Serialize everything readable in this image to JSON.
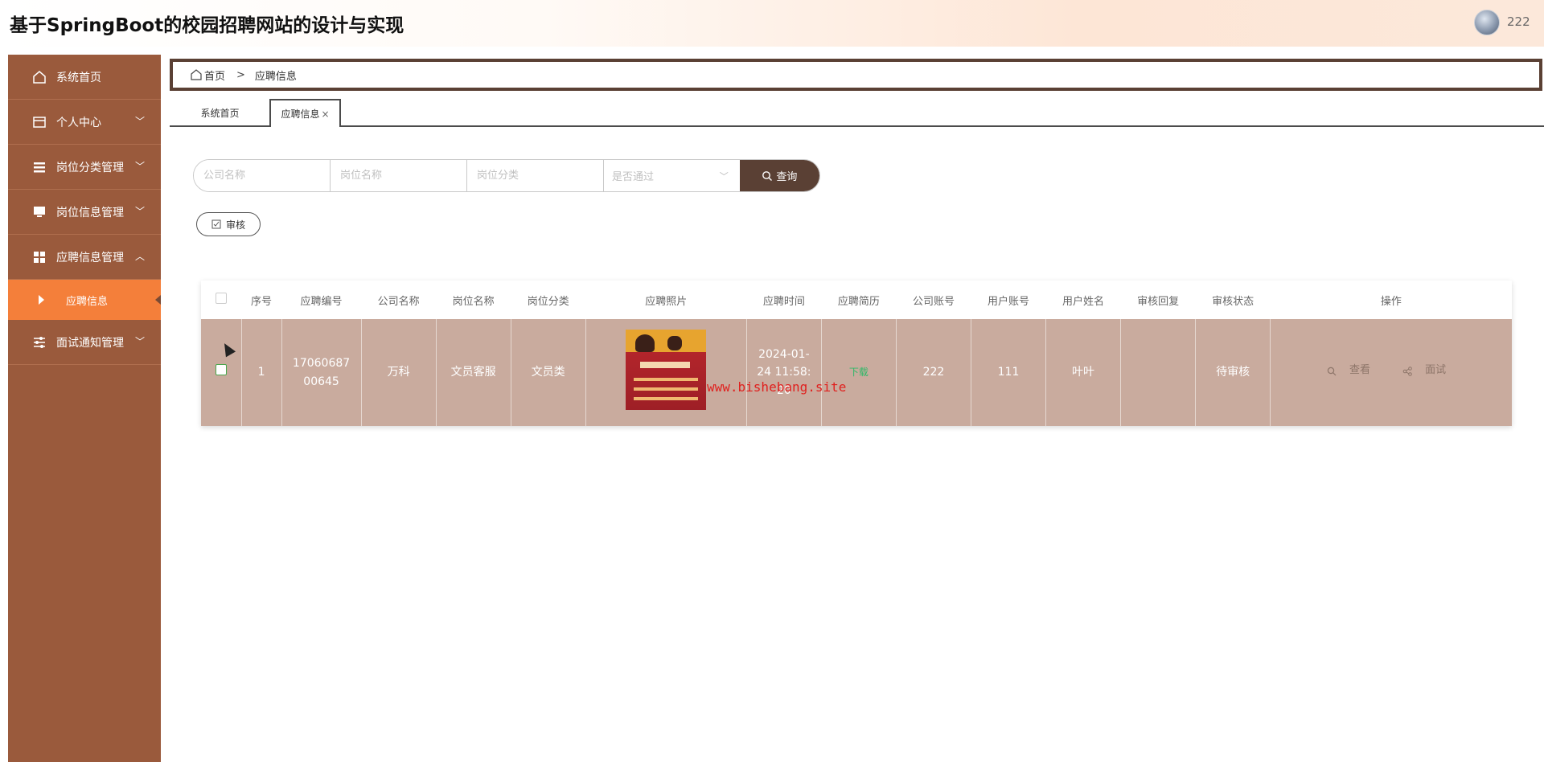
{
  "header": {
    "title": "基于SpringBoot的校园招聘网站的设计与实现",
    "username": "222"
  },
  "sidebar": {
    "items": [
      {
        "label": "系统首页",
        "icon": "home-icon"
      },
      {
        "label": "个人中心",
        "icon": "wallet-icon"
      },
      {
        "label": "岗位分类管理",
        "icon": "list-icon"
      },
      {
        "label": "岗位信息管理",
        "icon": "monitor-icon"
      },
      {
        "label": "应聘信息管理",
        "icon": "grid-icon"
      },
      {
        "label": "面试通知管理",
        "icon": "sliders-icon"
      }
    ],
    "active_sub": "应聘信息"
  },
  "breadcrumb": {
    "home": "首页",
    "sep": ">",
    "current": "应聘信息"
  },
  "tabs": [
    {
      "label": "系统首页"
    },
    {
      "label": "应聘信息",
      "close": "×"
    }
  ],
  "search": {
    "company_placeholder": "公司名称",
    "position_placeholder": "岗位名称",
    "category_placeholder": "岗位分类",
    "passed_placeholder": "是否通过",
    "button": "查询"
  },
  "audit_button": "审核",
  "table": {
    "headers": [
      "序号",
      "应聘编号",
      "公司名称",
      "岗位名称",
      "岗位分类",
      "应聘照片",
      "应聘时间",
      "应聘简历",
      "公司账号",
      "用户账号",
      "用户姓名",
      "审核回复",
      "审核状态",
      "操作"
    ],
    "rows": [
      {
        "index": "1",
        "application_no": "1706068700645",
        "company": "万科",
        "position": "文员客服",
        "category": "文员类",
        "time": "2024-01-24 11:58:20",
        "resume": "下载",
        "company_account": "222",
        "user_account": "111",
        "user_name": "叶叶",
        "reply": "",
        "status": "待审核",
        "view": "查看",
        "interview": "面试"
      }
    ]
  },
  "watermark": "www.bishebang.site"
}
